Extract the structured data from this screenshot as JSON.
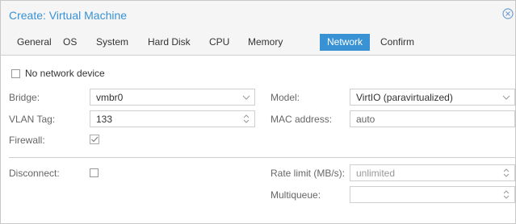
{
  "dialog": {
    "title": "Create: Virtual Machine",
    "close_icon": "close-circle-icon"
  },
  "tabs": [
    {
      "label": "General",
      "active": false
    },
    {
      "label": "OS",
      "active": false
    },
    {
      "label": "System",
      "active": false
    },
    {
      "label": "Hard Disk",
      "active": false
    },
    {
      "label": "CPU",
      "active": false
    },
    {
      "label": "Memory",
      "active": false
    },
    {
      "label": "Network",
      "active": true
    },
    {
      "label": "Confirm",
      "active": false
    }
  ],
  "form": {
    "no_network_device": {
      "label": "No network device",
      "checked": false
    },
    "bridge": {
      "label": "Bridge:",
      "value": "vmbr0"
    },
    "vlan_tag": {
      "label": "VLAN Tag:",
      "value": "133"
    },
    "firewall": {
      "label": "Firewall:",
      "checked": true
    },
    "model": {
      "label": "Model:",
      "value": "VirtIO (paravirtualized)"
    },
    "mac_address": {
      "label": "MAC address:",
      "value": "auto"
    },
    "disconnect": {
      "label": "Disconnect:",
      "checked": false
    },
    "rate_limit": {
      "label": "Rate limit (MB/s):",
      "placeholder": "unlimited"
    },
    "multiqueue": {
      "label": "Multiqueue:",
      "value": ""
    }
  },
  "colors": {
    "accent": "#3892d4",
    "tab_bar_bg": "#f5f5f5",
    "border": "#cfcfcf"
  }
}
